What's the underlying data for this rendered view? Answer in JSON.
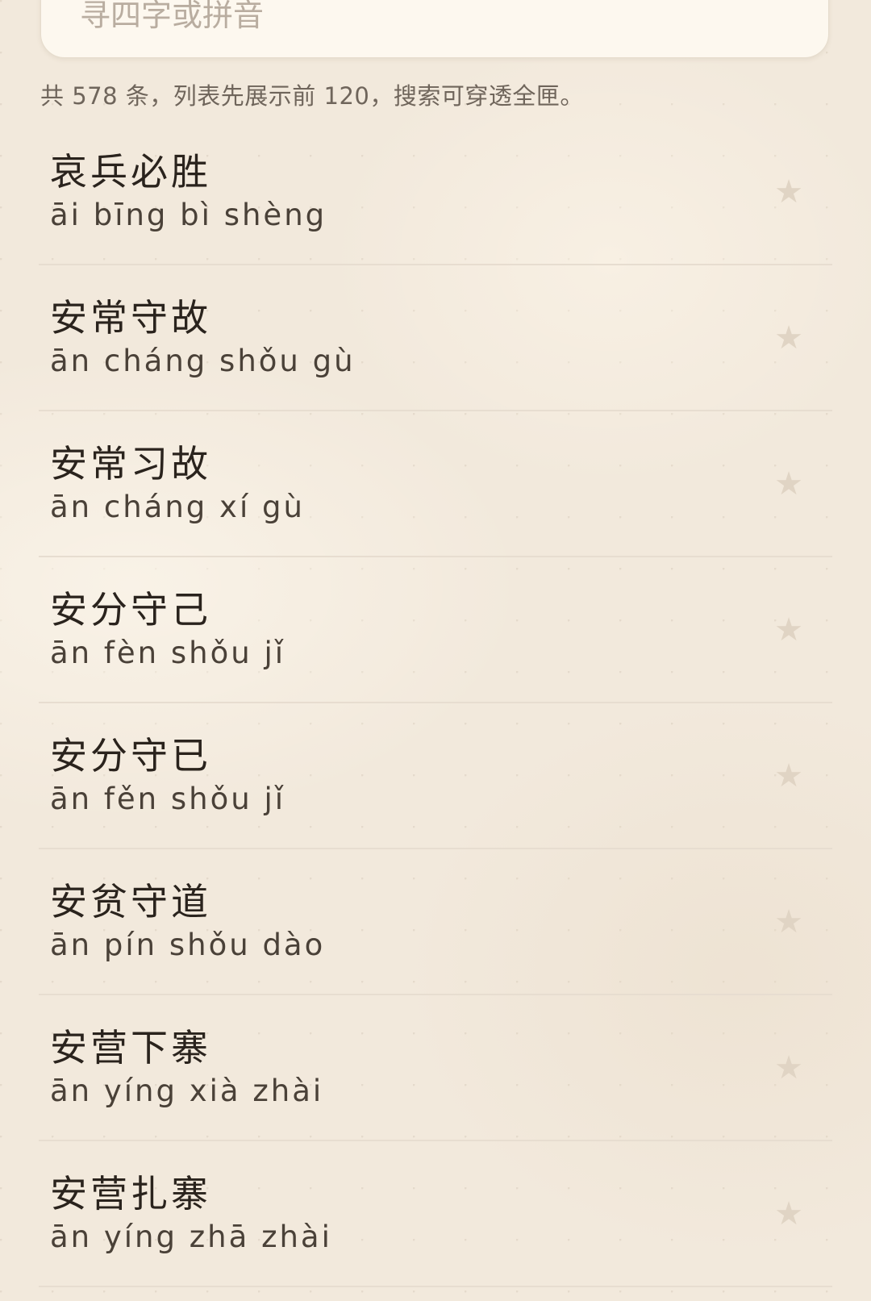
{
  "search": {
    "placeholder": "寻四字或拼音"
  },
  "summary": "共 578 条，列表先展示前 120，搜索可穿透全匣。",
  "icons": {
    "favorite": "star-icon"
  },
  "colors": {
    "background": "#f2e9dc",
    "star": "#e0d4c4"
  },
  "idioms": [
    {
      "text": "哀兵必胜",
      "pinyin": "āi bīng bì shèng"
    },
    {
      "text": "安常守故",
      "pinyin": "ān cháng shǒu gù"
    },
    {
      "text": "安常习故",
      "pinyin": "ān cháng xí gù"
    },
    {
      "text": "安分守己",
      "pinyin": "ān fèn shǒu jǐ"
    },
    {
      "text": "安分守已",
      "pinyin": "ān fěn shǒu jǐ"
    },
    {
      "text": "安贫守道",
      "pinyin": "ān pín shǒu dào"
    },
    {
      "text": "安营下寨",
      "pinyin": "ān yíng xià zhài"
    },
    {
      "text": "安营扎寨",
      "pinyin": "ān yíng zhā zhài"
    }
  ]
}
